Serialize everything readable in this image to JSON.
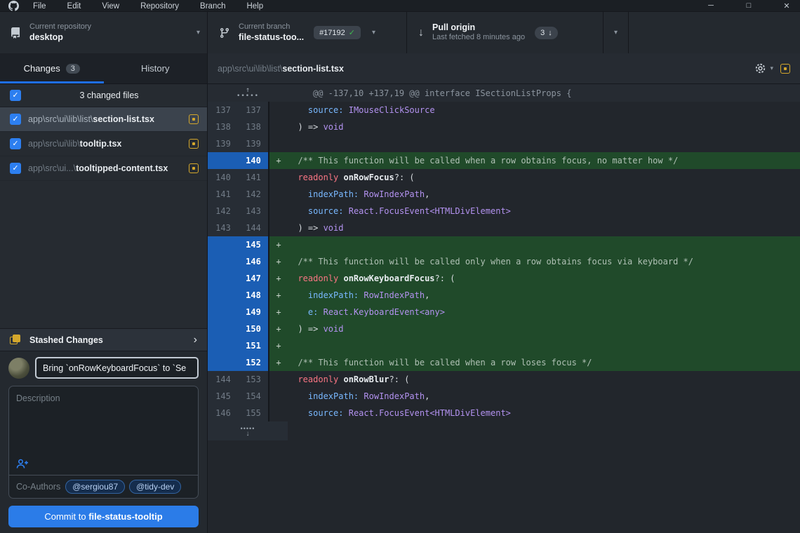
{
  "icons": {
    "check": "✓",
    "caret": "▾",
    "chevron": "›",
    "arrow_down": "↓",
    "arrow_up": "↑",
    "dots": "•••••",
    "plus": "+"
  },
  "menubar": {
    "items": [
      "File",
      "Edit",
      "View",
      "Repository",
      "Branch",
      "Help"
    ],
    "window_controls": [
      {
        "name": "minimize",
        "glyph": "─"
      },
      {
        "name": "maximize",
        "glyph": "□"
      },
      {
        "name": "close",
        "glyph": "✕"
      }
    ]
  },
  "toolbar": {
    "repo": {
      "label": "Current repository",
      "name": "desktop"
    },
    "branch": {
      "label": "Current branch",
      "name": "file-status-too...",
      "badge": "#17192"
    },
    "pull": {
      "title": "Pull origin",
      "subtitle": "Last fetched 8 minutes ago",
      "badge_count": "3"
    }
  },
  "sidebar": {
    "tabs": {
      "changes_label": "Changes",
      "changes_badge": "3",
      "history_label": "History"
    },
    "files_header": "3 changed files",
    "files": [
      {
        "prefix": "app\\src\\ui\\lib\\list\\",
        "name": "section-list.tsx",
        "selected": true
      },
      {
        "prefix": "app\\src\\ui\\lib\\",
        "name": "tooltip.tsx",
        "selected": false
      },
      {
        "prefix": "app\\src\\ui...\\",
        "name": "tooltipped-content.tsx",
        "selected": false
      }
    ],
    "stashed_label": "Stashed Changes"
  },
  "commit": {
    "summary_value": "Bring `onRowKeyboardFocus` to `Se",
    "description_placeholder": "Description",
    "coauthors": {
      "label": "Co-Authors",
      "pills": [
        "@sergiou87",
        "@tidy-dev"
      ]
    },
    "button_prefix": "Commit to ",
    "button_branch": "file-status-tooltip"
  },
  "diff": {
    "header": {
      "path_prefix": "app\\src\\ui\\lib\\list\\",
      "path_file": "section-list.tsx"
    },
    "hunk_header": "@@ -137,10 +137,19 @@ interface ISectionListProps {",
    "rows": [
      {
        "old": "137",
        "new": "137",
        "add": false,
        "tokens": [
          [
            "    source:",
            "prop"
          ],
          [
            " ",
            "pl"
          ],
          [
            "IMouseClickSource",
            "type"
          ]
        ]
      },
      {
        "old": "138",
        "new": "138",
        "add": false,
        "tokens": [
          [
            "  ) => ",
            "pl"
          ],
          [
            "void",
            "type"
          ]
        ]
      },
      {
        "old": "139",
        "new": "139",
        "add": false,
        "tokens": []
      },
      {
        "old": "",
        "new": "140",
        "add": true,
        "tokens": [
          [
            "  /** This function will be called when a row obtains focus, no matter how */",
            "cmt"
          ]
        ]
      },
      {
        "old": "140",
        "new": "141",
        "add": false,
        "tokens": [
          [
            "  readonly",
            "kw"
          ],
          [
            " ",
            "pl"
          ],
          [
            "onRowFocus",
            "name"
          ],
          [
            "?: (",
            "pl"
          ]
        ]
      },
      {
        "old": "141",
        "new": "142",
        "add": false,
        "tokens": [
          [
            "    indexPath:",
            "prop"
          ],
          [
            " ",
            "pl"
          ],
          [
            "RowIndexPath",
            "type"
          ],
          [
            ",",
            "pl"
          ]
        ]
      },
      {
        "old": "142",
        "new": "143",
        "add": false,
        "tokens": [
          [
            "    source:",
            "prop"
          ],
          [
            " ",
            "pl"
          ],
          [
            "React.FocusEvent<HTMLDivElement>",
            "type"
          ]
        ]
      },
      {
        "old": "143",
        "new": "144",
        "add": false,
        "tokens": [
          [
            "  ) => ",
            "pl"
          ],
          [
            "void",
            "type"
          ]
        ]
      },
      {
        "old": "",
        "new": "145",
        "add": true,
        "tokens": []
      },
      {
        "old": "",
        "new": "146",
        "add": true,
        "tokens": [
          [
            "  /** This function will be called only when a row obtains focus via keyboard */",
            "cmt"
          ]
        ]
      },
      {
        "old": "",
        "new": "147",
        "add": true,
        "tokens": [
          [
            "  readonly",
            "kw"
          ],
          [
            " ",
            "pl"
          ],
          [
            "onRowKeyboardFocus",
            "name"
          ],
          [
            "?: (",
            "pl"
          ]
        ]
      },
      {
        "old": "",
        "new": "148",
        "add": true,
        "tokens": [
          [
            "    indexPath:",
            "prop"
          ],
          [
            " ",
            "pl"
          ],
          [
            "RowIndexPath",
            "type"
          ],
          [
            ",",
            "pl"
          ]
        ]
      },
      {
        "old": "",
        "new": "149",
        "add": true,
        "tokens": [
          [
            "    e:",
            "prop"
          ],
          [
            " ",
            "pl"
          ],
          [
            "React.KeyboardEvent<any>",
            "type"
          ]
        ]
      },
      {
        "old": "",
        "new": "150",
        "add": true,
        "tokens": [
          [
            "  ) => ",
            "pl"
          ],
          [
            "void",
            "type"
          ]
        ]
      },
      {
        "old": "",
        "new": "151",
        "add": true,
        "tokens": []
      },
      {
        "old": "",
        "new": "152",
        "add": true,
        "tokens": [
          [
            "  /** This function will be called when a row loses focus */",
            "cmt"
          ]
        ]
      },
      {
        "old": "144",
        "new": "153",
        "add": false,
        "tokens": [
          [
            "  readonly",
            "kw"
          ],
          [
            " ",
            "pl"
          ],
          [
            "onRowBlur",
            "name"
          ],
          [
            "?: (",
            "pl"
          ]
        ]
      },
      {
        "old": "145",
        "new": "154",
        "add": false,
        "tokens": [
          [
            "    indexPath:",
            "prop"
          ],
          [
            " ",
            "pl"
          ],
          [
            "RowIndexPath",
            "type"
          ],
          [
            ",",
            "pl"
          ]
        ]
      },
      {
        "old": "146",
        "new": "155",
        "add": false,
        "tokens": [
          [
            "    source:",
            "prop"
          ],
          [
            " ",
            "pl"
          ],
          [
            "React.FocusEvent<HTMLDivElement>",
            "type"
          ]
        ]
      }
    ]
  }
}
